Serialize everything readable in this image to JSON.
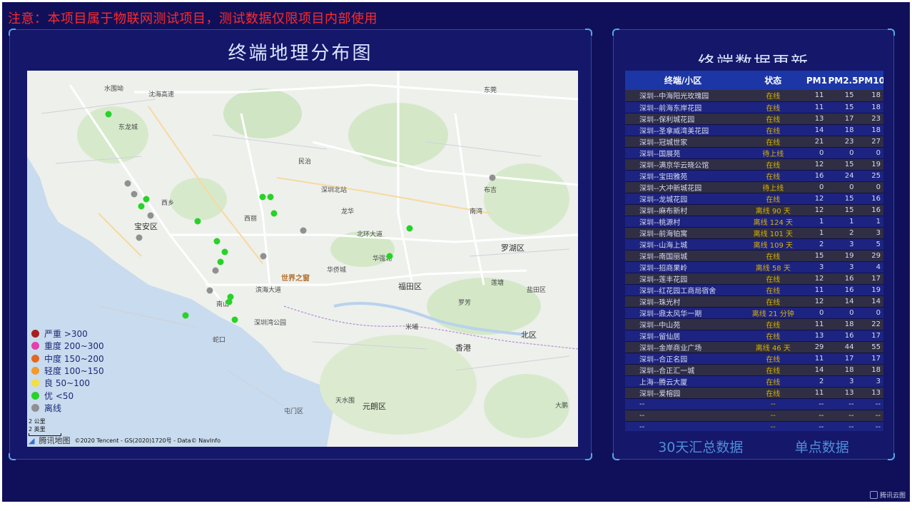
{
  "notice": "注意：本项目属于物联网测试项目，测试数据仅限项目内部使用",
  "map_panel": {
    "title": "终端地理分布图",
    "places": [
      "水围坳",
      "沈海高速",
      "东龙城",
      "宝安区",
      "西乡",
      "西丽",
      "南山",
      "北环大道",
      "罗湖区",
      "福田区",
      "世界之窗",
      "深圳湾公园",
      "滨海大道",
      "蛇口",
      "华侨城",
      "深圳北站",
      "布吉",
      "香港",
      "元朗区",
      "屯门区",
      "北区",
      "米埔",
      "天水围",
      "盐田区",
      "东莞",
      "罗芳",
      "华强北",
      "大鹏",
      "莲塘",
      "南湾",
      "民治",
      "龙华"
    ],
    "legend": [
      {
        "label": "严重 >300",
        "color": "#a81e1e"
      },
      {
        "label": "重度 200~300",
        "color": "#e63eaa"
      },
      {
        "label": "中度 150~200",
        "color": "#e46820"
      },
      {
        "label": "轻度 100~150",
        "color": "#f39a2a"
      },
      {
        "label": "良 50~100",
        "color": "#f2e040"
      },
      {
        "label": "优 <50",
        "color": "#28d228"
      },
      {
        "label": "离线",
        "color": "#909090"
      }
    ],
    "scale_km": "2 公里",
    "scale_mi": "2 英里",
    "logo": "腾讯地图",
    "attribution": "©2020 Tencent - GS(2020)1720号 - Data© NavInfo",
    "points_online_color": "#28d228",
    "points_offline_color": "#909090"
  },
  "data_panel": {
    "title": "终端数据更新",
    "headers": [
      "终端/小区",
      "状态",
      "PM1",
      "PM2.5",
      "PM10"
    ],
    "rows": [
      [
        "深圳--中海阳光玫瑰园",
        "在线",
        "11",
        "15",
        "18"
      ],
      [
        "深圳--前海东岸花园",
        "在线",
        "11",
        "15",
        "18"
      ],
      [
        "深圳--保利城花园",
        "在线",
        "13",
        "17",
        "23"
      ],
      [
        "深圳--圣拿威湾美花园",
        "在线",
        "14",
        "18",
        "18"
      ],
      [
        "深圳--冠城世家",
        "在线",
        "21",
        "23",
        "27"
      ],
      [
        "深圳--国展苑",
        "待上线",
        "0",
        "0",
        "0"
      ],
      [
        "深圳--满京华云晓公馆",
        "在线",
        "12",
        "15",
        "19"
      ],
      [
        "深圳--宝田雅苑",
        "在线",
        "16",
        "24",
        "25"
      ],
      [
        "深圳--大冲新城花园",
        "待上线",
        "0",
        "0",
        "0"
      ],
      [
        "深圳--龙城花园",
        "在线",
        "12",
        "15",
        "16"
      ],
      [
        "深圳--麻布新村",
        "离线 90 天",
        "12",
        "15",
        "16"
      ],
      [
        "深圳--桃源村",
        "离线 124 天",
        "1",
        "1",
        "1"
      ],
      [
        "深圳--前海铂寓",
        "离线 101 天",
        "1",
        "2",
        "3"
      ],
      [
        "深圳--山海上城",
        "离线 109 天",
        "2",
        "3",
        "5"
      ],
      [
        "深圳--南国丽城",
        "在线",
        "15",
        "19",
        "29"
      ],
      [
        "深圳--招商果岭",
        "离线 58 天",
        "3",
        "3",
        "4"
      ],
      [
        "深圳--莲丰花园",
        "在线",
        "12",
        "16",
        "17"
      ],
      [
        "深圳--红花园工商局宿舍",
        "在线",
        "11",
        "16",
        "19"
      ],
      [
        "深圳--珠光村",
        "在线",
        "12",
        "14",
        "14"
      ],
      [
        "深圳--鼎太风华一期",
        "离线 21 分钟",
        "0",
        "0",
        "0"
      ],
      [
        "深圳--中山苑",
        "在线",
        "11",
        "18",
        "22"
      ],
      [
        "深圳--留仙居",
        "在线",
        "13",
        "16",
        "17"
      ],
      [
        "深圳--金岸商业广场",
        "离线 46 天",
        "29",
        "44",
        "55"
      ],
      [
        "深圳--合正名园",
        "在线",
        "11",
        "17",
        "17"
      ],
      [
        "深圳--合正汇一城",
        "在线",
        "14",
        "18",
        "18"
      ],
      [
        "上海--腾云大厦",
        "在线",
        "2",
        "3",
        "3"
      ],
      [
        "深圳--爱榕园",
        "在线",
        "11",
        "13",
        "13"
      ],
      [
        "--",
        "--",
        "--",
        "--",
        "--"
      ],
      [
        "--",
        "--",
        "--",
        "--",
        "--"
      ],
      [
        "--",
        "--",
        "--",
        "--",
        "--"
      ]
    ],
    "tabs": [
      "30天汇总数据",
      "单点数据"
    ]
  },
  "brand": "腾讯云图"
}
